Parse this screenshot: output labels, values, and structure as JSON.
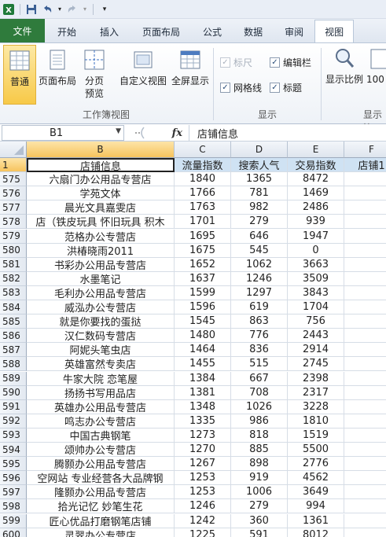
{
  "qat": {
    "app_icon": "excel-icon",
    "save_icon": "save-icon",
    "undo_icon": "undo-icon",
    "redo_icon": "redo-icon",
    "customize_icon": "customize-icon"
  },
  "tabs": [
    {
      "label": "文件"
    },
    {
      "label": "开始"
    },
    {
      "label": "插入"
    },
    {
      "label": "页面布局"
    },
    {
      "label": "公式"
    },
    {
      "label": "数据"
    },
    {
      "label": "审阅"
    },
    {
      "label": "视图"
    }
  ],
  "ribbon": {
    "normal": "普通",
    "page_layout": "页面布局",
    "page_break_1": "分页",
    "page_break_2": "预览",
    "custom_view": "自定义视图",
    "fullscreen": "全屏显示",
    "group_workbook_views": "工作簿视图",
    "ruler": "标尺",
    "gridlines": "网格线",
    "formula_bar": "编辑栏",
    "headings": "标题",
    "group_show": "显示",
    "zoom": "显示比例",
    "zoom_100": "100",
    "group_zoom": "显示比"
  },
  "formula_bar": {
    "name_box": "B1",
    "fx": "fx",
    "content": "店铺信息"
  },
  "columns": [
    "B",
    "C",
    "D",
    "E",
    "F"
  ],
  "header_row": {
    "num": "1",
    "cells": [
      "店铺信息",
      "流量指数",
      "搜索人气",
      "交易指数",
      "店铺1"
    ]
  },
  "rows": [
    {
      "num": "575",
      "name": "六扇门办公用品专营店",
      "c": "1840",
      "d": "1365",
      "e": "8472"
    },
    {
      "num": "576",
      "name": "学苑文体",
      "c": "1766",
      "d": "781",
      "e": "1469"
    },
    {
      "num": "577",
      "name": "晨光文具嘉雯店",
      "c": "1763",
      "d": "982",
      "e": "2486"
    },
    {
      "num": "578",
      "name": "店（铁皮玩具 怀旧玩具 积木",
      "c": "1701",
      "d": "279",
      "e": "939"
    },
    {
      "num": "579",
      "name": "范格办公专营店",
      "c": "1695",
      "d": "646",
      "e": "1947"
    },
    {
      "num": "580",
      "name": "洪椿晓雨2011",
      "c": "1675",
      "d": "545",
      "e": "0"
    },
    {
      "num": "581",
      "name": "书彩办公用品专营店",
      "c": "1652",
      "d": "1062",
      "e": "3663"
    },
    {
      "num": "582",
      "name": "水墨笔记",
      "c": "1637",
      "d": "1246",
      "e": "3509"
    },
    {
      "num": "583",
      "name": "毛利办公用品专营店",
      "c": "1599",
      "d": "1297",
      "e": "3843"
    },
    {
      "num": "584",
      "name": "威泓办公专营店",
      "c": "1596",
      "d": "619",
      "e": "1704"
    },
    {
      "num": "585",
      "name": "就是你要找的蛋挞",
      "c": "1545",
      "d": "863",
      "e": "756"
    },
    {
      "num": "586",
      "name": "汉仁数码专营店",
      "c": "1480",
      "d": "776",
      "e": "2443"
    },
    {
      "num": "587",
      "name": "阿妮头笔虫店",
      "c": "1464",
      "d": "836",
      "e": "2914"
    },
    {
      "num": "588",
      "name": "英雄富然专卖店",
      "c": "1455",
      "d": "515",
      "e": "2745"
    },
    {
      "num": "589",
      "name": "牛家大院  恋笔屋",
      "c": "1384",
      "d": "667",
      "e": "2398"
    },
    {
      "num": "590",
      "name": "扬扬书写用品店",
      "c": "1381",
      "d": "708",
      "e": "2317"
    },
    {
      "num": "591",
      "name": "英雄办公用品专营店",
      "c": "1348",
      "d": "1026",
      "e": "3228"
    },
    {
      "num": "592",
      "name": "鸣志办公专营店",
      "c": "1335",
      "d": "986",
      "e": "1810"
    },
    {
      "num": "593",
      "name": "中国古典钢笔",
      "c": "1273",
      "d": "818",
      "e": "1519"
    },
    {
      "num": "594",
      "name": "颂帅办公专营店",
      "c": "1270",
      "d": "885",
      "e": "5500"
    },
    {
      "num": "595",
      "name": "腾颢办公用品专营店",
      "c": "1267",
      "d": "898",
      "e": "2776"
    },
    {
      "num": "596",
      "name": "空网站 专业经营各大品牌钢",
      "c": "1253",
      "d": "919",
      "e": "4562"
    },
    {
      "num": "597",
      "name": "隆颢办公用品专营店",
      "c": "1253",
      "d": "1006",
      "e": "3649"
    },
    {
      "num": "598",
      "name": "拾光记忆 妙笔生花",
      "c": "1246",
      "d": "279",
      "e": "994"
    },
    {
      "num": "599",
      "name": "匠心优品打磨钢笔店铺",
      "c": "1242",
      "d": "360",
      "e": "1361"
    },
    {
      "num": "600",
      "name": "灵翠办公专营店",
      "c": "1225",
      "d": "591",
      "e": "8012"
    }
  ]
}
